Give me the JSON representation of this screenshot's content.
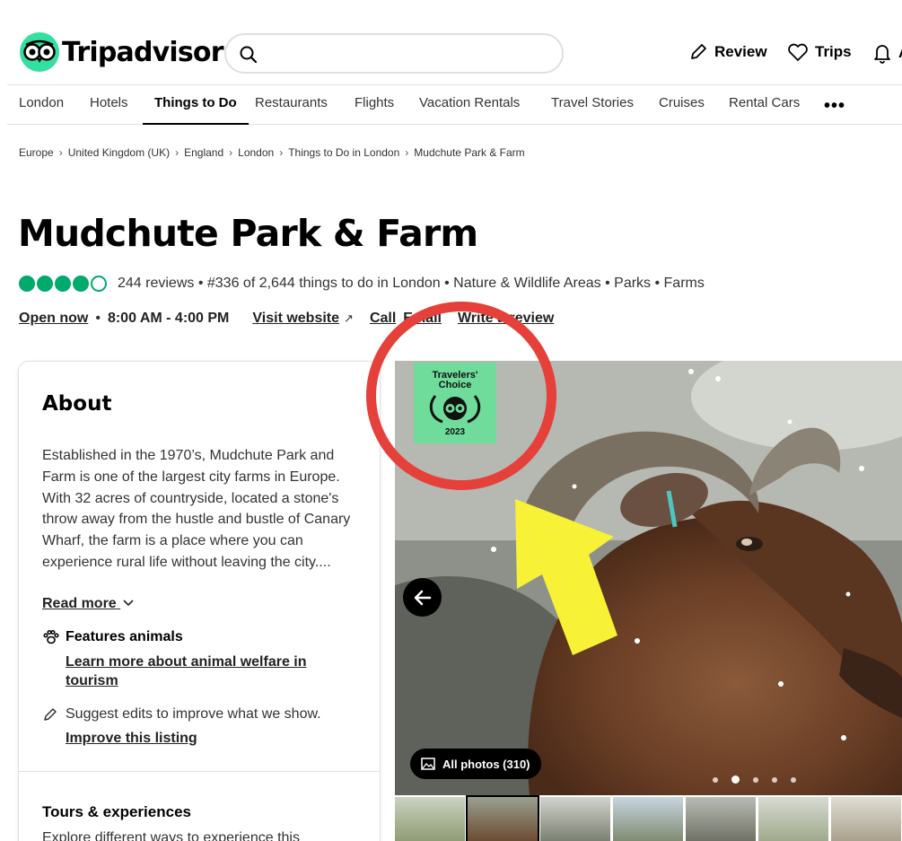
{
  "header": {
    "brand": "Tripadvisor",
    "search": {
      "placeholder": "",
      "value": ""
    },
    "actions": [
      {
        "label": "Review",
        "icon": "pencil-icon"
      },
      {
        "label": "Trips",
        "icon": "heart-icon"
      },
      {
        "label": "A",
        "icon": "bell-icon"
      }
    ]
  },
  "nav": {
    "items": [
      "London",
      "Hotels",
      "Things to Do",
      "Restaurants",
      "Flights",
      "Vacation Rentals",
      "Travel Stories",
      "Cruises",
      "Rental Cars"
    ],
    "active": "Things to Do",
    "more": "•••"
  },
  "breadcrumb": [
    "Europe",
    "United Kingdom (UK)",
    "England",
    "London",
    "Things to Do in London",
    "Mudchute Park & Farm"
  ],
  "title": "Mudchute Park & Farm",
  "rating": {
    "value": 4,
    "max": 5,
    "reviews": "244 reviews",
    "summary": "• #336 of 2,644 things to do in London • Nature & Wildlife Areas • Parks • Farms"
  },
  "info": {
    "open": "Open now",
    "hours": "8:00 AM - 4:00 PM",
    "website": "Visit website",
    "call": "Call",
    "email": "Email",
    "write_review": "Write a review"
  },
  "about": {
    "title": "About",
    "text": "Established in the 1970’s, Mudchute Park and Farm is one of the largest city farms in Europe.   With 32 acres of countryside, located a stone's throw away from the hustle and bustle of Canary Wharf, the farm is a place where you can experience rural life without leaving the city....",
    "read_more": "Read more",
    "features_label": "Features animals",
    "features_link": "Learn more about animal welfare in tourism",
    "suggest": "Suggest edits to improve what we show.",
    "improve": "Improve this listing",
    "tours_title": "Tours & experiences",
    "tours_text": "Explore different ways to experience this"
  },
  "gallery": {
    "badge": {
      "line1": "Travelers'",
      "line2": "Choice",
      "year": "2023"
    },
    "all_photos": "All photos (310)",
    "slide_count": 5,
    "active_slide": 2
  },
  "colors": {
    "brand": "#34e0a1",
    "bubble": "#00aa6c",
    "badge": "#6fdc9b",
    "annotation_circle": "#e5403a",
    "annotation_arrow": "#f7f236"
  }
}
